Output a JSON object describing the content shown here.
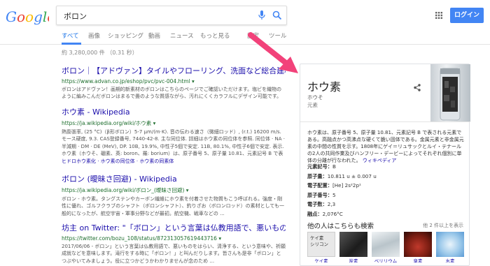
{
  "header": {
    "search_query": "ボロン",
    "login_label": "ログイン"
  },
  "tabs": [
    {
      "label": "すべて"
    },
    {
      "label": "画像"
    },
    {
      "label": "ショッピング"
    },
    {
      "label": "動画"
    },
    {
      "label": "ニュース"
    },
    {
      "label": "もっと見る"
    },
    {
      "label": "設定"
    },
    {
      "label": "ツール"
    }
  ],
  "result_stats": "約 3,280,000 件 （0.31 秒）",
  "results": [
    {
      "title": "ボロン｜【アドヴァン】タイルやフローリング、洗面など総合建材の",
      "url": "https://www.advan.co.jp/eshop/pvc/pvc-004.html ▾",
      "snippet": "ボロンはアドヴァン！画期的新素材のボロンはこちらのページでご確認いただけます。塩ビを織物のように編みこんだボロンはまるで畳のような質感ながら、汚れにくくカラフルにデザイン可能です。"
    },
    {
      "title": "ホウ素 - Wikipedia",
      "url": "https://ja.wikipedia.org/wiki/ホウ素 ▾",
      "snippet": "熱膨張率, (25 °C)（β形ボロン）5-7 μm/(m·K). 音の伝わる速さ（微細ロッド）, (r.t.) 16200 m/s. モース硬度, 9.3. CAS登録番号, 7440-42-8. 主な同位体. 詳細はホウ素の同位体を参照. 同位体 · NA · 半減期 · DM · DE (MeV), DP. 10B, 19.9%, 中性子5個で安定. 11B, 80.1%, 中性子6個で安定. 表示. ホウ素（ホウそ、硼素、英: boron、羅: borium）は、原子番号 5、原子量 10.81、元素記号 B で表される元素である。高融点かつ高沸点な硬くて脆い固体である。",
      "links": "ヒドロホウ素化 · ホウ素の同位体 · ホウ素の同素体"
    },
    {
      "title": "ボロン (曖昧さ回避) - Wikipedia",
      "url": "https://ja.wikipedia.org/wiki/ボロン_(曖昧さ回避) ▾",
      "snippet": "ボロン - ホウ素。タングステンやカーボン繊維にホウ素を付着させた物質もこう呼ばれる。強度・剛性に優れ、ゴルフクラブのシャフト（ボロンシャフト）、釣りざお（ボロンロッド）の素材としても一般的になったが、航空宇宙・軍事分野などが最初。航空機、戦車などの ..."
    },
    {
      "title": "坊主 on Twitter: \"「ボロン」という言葉は仏教用語で、悪いものをはら...",
      "url": "https://twitter.com/bozu_108/status/872313057619443716 ▾",
      "snippet": "2017/06/06 - ボロン」という言葉は仏教用語で、悪いものをはらい、清浄する、という意味や、祈願成就などを意味します。滝行をする時に「ボロン！」と叫んだりします。皆さんも是非「ボロン」とつぶやいてみましょう。役に立つかどうかわかりませんが念のため ..."
    }
  ],
  "knowledge_panel": {
    "title": "ホウ素",
    "reading": "ホウそ",
    "category": "元素",
    "description": "ホウ素は、原子番号 5、原子量 10.81、元素記号 B で表される元素である。高融点かつ高沸点な硬くて脆い固体である。金属元素と非金属元素の中間の性質を示す。1808年にゲイ＝リュサックとルイ・テナールの2人の共同作業及びハンフリー・デービーによってそれぞれ個別に単体の分離が行なわれた。",
    "description_source": "ウィキペディア",
    "facts": [
      {
        "label": "元素記号：",
        "value": "B"
      },
      {
        "label": "原子量：",
        "value": "10.811 u ± 0.007 u"
      },
      {
        "label": "電子配置：",
        "value": "[He] 2s²2p¹"
      },
      {
        "label": "原子番号：",
        "value": "5"
      },
      {
        "label": "電子数：",
        "value": "2,3"
      },
      {
        "label": "融点：",
        "value": "2,076°C"
      }
    ],
    "others_heading": "他の人はこちらも検索",
    "others_count": "他 2 件以上を表示",
    "others": [
      {
        "label": "ケイ素",
        "thumb_text": "ケイ素\nシリコン",
        "color": "#e8e8e8"
      },
      {
        "label": "炭素",
        "color": "#3a3a3a"
      },
      {
        "label": "ベリリウム",
        "color": "#cfd8dc"
      },
      {
        "label": "臭素",
        "color": "#7a1d12"
      },
      {
        "label": "水素",
        "color": "#5b9bd5"
      }
    ]
  },
  "colors": {
    "accent": "#4285f4",
    "arrow": "#f2427a",
    "link": "#1a0dab",
    "url": "#1e6e2e"
  }
}
